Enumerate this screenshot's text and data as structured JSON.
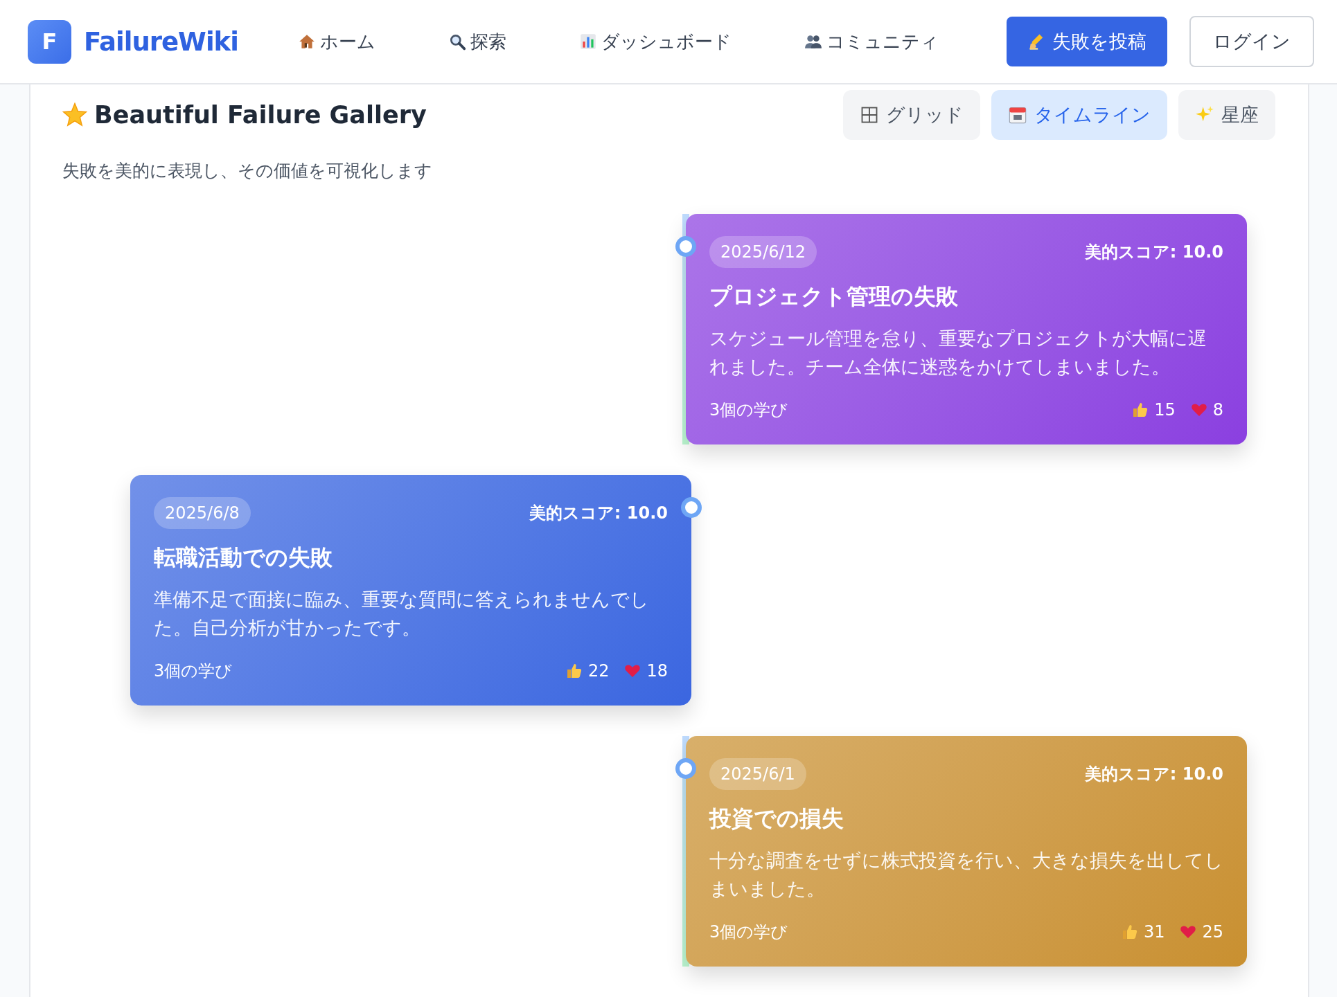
{
  "header": {
    "logo_letter": "F",
    "site_name": "FailureWiki",
    "nav": [
      {
        "label": "ホーム"
      },
      {
        "label": "探索"
      },
      {
        "label": "ダッシュボード"
      },
      {
        "label": "コミュニティ"
      }
    ],
    "post_button": "失敗を投稿",
    "login_button": "ログイン"
  },
  "gallery": {
    "title": "Beautiful Failure Gallery",
    "subtitle": "失敗を美的に表現し、その価値を可視化します",
    "views": [
      {
        "label": "グリッド",
        "selected": false
      },
      {
        "label": "タイムライン",
        "selected": true
      },
      {
        "label": "星座",
        "selected": false
      }
    ]
  },
  "entries": [
    {
      "date": "2025/6/12",
      "score": "美的スコア: 10.0",
      "title": "プロジェクト管理の失敗",
      "description": "スケジュール管理を怠り、重要なプロジェクトが大幅に遅れました。チーム全体に迷惑をかけてしまいました。",
      "lessons": "3個の学び",
      "likes": "15",
      "hearts": "8",
      "color": "#8b3fe0"
    },
    {
      "date": "2025/6/8",
      "score": "美的スコア: 10.0",
      "title": "転職活動での失敗",
      "description": "準備不足で面接に臨み、重要な質問に答えられませんでした。自己分析が甘かったです。",
      "lessons": "3個の学び",
      "likes": "22",
      "hearts": "18",
      "color": "#3b66e0"
    },
    {
      "date": "2025/6/1",
      "score": "美的スコア: 10.0",
      "title": "投資での損失",
      "description": "十分な調査をせずに株式投資を行い、大きな損失を出してしまいました。",
      "lessons": "3個の学び",
      "likes": "31",
      "hearts": "25",
      "color": "#c99030"
    }
  ]
}
